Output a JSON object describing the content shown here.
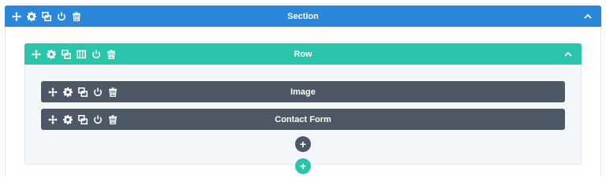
{
  "section": {
    "title": "Section",
    "icons": [
      "move-icon",
      "settings-icon",
      "duplicate-icon",
      "toggle-icon",
      "delete-icon"
    ]
  },
  "row": {
    "title": "Row",
    "icons": [
      "move-icon",
      "settings-icon",
      "duplicate-icon",
      "columns-icon",
      "toggle-icon",
      "delete-icon"
    ]
  },
  "modules": [
    {
      "title": "Image"
    },
    {
      "title": "Contact Form"
    }
  ],
  "add_module": {
    "label": "+"
  },
  "add_row": {
    "label": "+"
  },
  "colors": {
    "section": "#2b87da",
    "row": "#29c4a9",
    "module": "#4d5866"
  }
}
